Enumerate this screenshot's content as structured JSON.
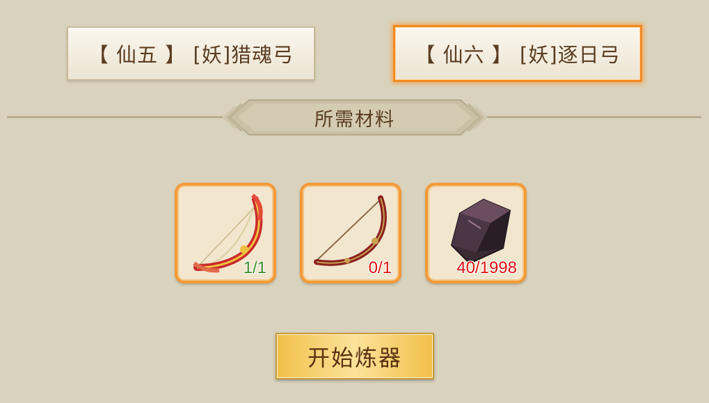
{
  "recipe_tabs": [
    {
      "label": "【 仙五 】 [妖]猎魂弓",
      "selected": false
    },
    {
      "label": "【 仙六 】 [妖]逐日弓",
      "selected": true
    }
  ],
  "materials_header": "所需材料",
  "materials": [
    {
      "icon": "red-bow-icon",
      "count": "1/1",
      "sufficient": true
    },
    {
      "icon": "dark-bow-icon",
      "count": "0/1",
      "sufficient": false
    },
    {
      "icon": "dark-crystal-icon",
      "count": "40/1998",
      "sufficient": false
    }
  ],
  "forge_button_label": "开始炼器",
  "colors": {
    "background": "#d9d3bd",
    "tab_selected_border": "#f08a24",
    "slot_border": "#f29a38",
    "count_ok": "#3a8a2a",
    "count_lack": "#e01010",
    "button_gold": "#f2c04a"
  }
}
